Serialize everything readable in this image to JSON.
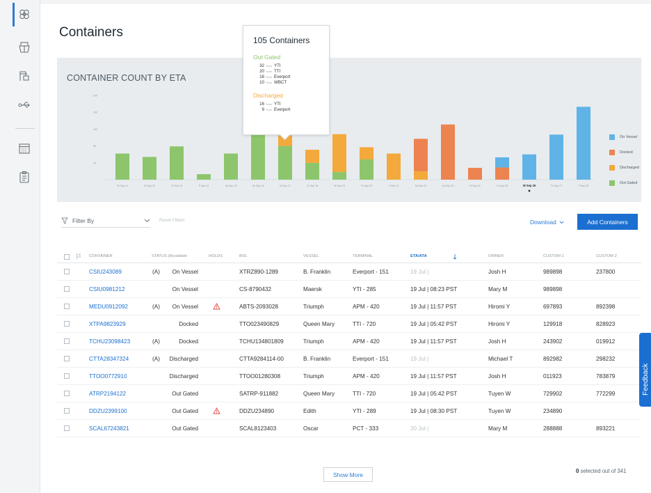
{
  "page": {
    "title": "Containers"
  },
  "sidebar": {
    "icons": [
      "containers-icon",
      "vessel-icon",
      "terminal-icon",
      "usb-route-icon",
      "calendar-icon",
      "clipboard-icon"
    ]
  },
  "chart": {
    "title": "CONTAINER COUNT BY ETA"
  },
  "tooltip": {
    "title": "105 Containers",
    "groups": [
      {
        "name": "Out Gated",
        "color": "#8dc56c",
        "rows": [
          {
            "count": "32",
            "from": "from",
            "terminal": "YTI"
          },
          {
            "count": "20",
            "from": "from",
            "terminal": "TTI"
          },
          {
            "count": "18",
            "from": "from",
            "terminal": "Everport"
          },
          {
            "count": "10",
            "from": "from",
            "terminal": "WBCT"
          }
        ]
      },
      {
        "name": "Discharged",
        "color": "#f3a93b",
        "rows": [
          {
            "count": "16",
            "from": "from",
            "terminal": "YTI"
          },
          {
            "count": "9",
            "from": "from",
            "terminal": "Everport"
          }
        ]
      }
    ]
  },
  "chart_data": {
    "type": "bar",
    "title": "CONTAINER COUNT BY ETA",
    "stacked": true,
    "categories": [
      "Tu Sep 11",
      "W Sep 12",
      "Th Sep 13",
      "F Sep 14",
      "Sa Sep 15",
      "Su Sep 16",
      "M Sep 17",
      "Tu Sep 18",
      "W Sep 19",
      "Th Sep 20",
      "F Sep 21",
      "Sa Sep 22",
      "Su Sep 23",
      "M Sep 24",
      "Tu Sep 25",
      "W Sep 26",
      "Th Sep 27",
      "F Sep 28"
    ],
    "highlighted_category": "W Sep 26",
    "y_ticks": [
      "40",
      "80",
      "120",
      "160",
      "200"
    ],
    "ylim": [
      0,
      210
    ],
    "legend_position": "right",
    "series": [
      {
        "name": "On Vessel",
        "color": "#5fb3e6",
        "values": [
          0,
          0,
          0,
          0,
          0,
          0,
          0,
          0,
          0,
          0,
          0,
          0,
          0,
          0,
          24,
          60,
          107,
          173
        ]
      },
      {
        "name": "Docked",
        "color": "#ec8350",
        "values": [
          0,
          0,
          0,
          0,
          0,
          0,
          0,
          0,
          0,
          0,
          0,
          77,
          131,
          28,
          29,
          0,
          0,
          0
        ]
      },
      {
        "name": "Discharged",
        "color": "#f3a93b",
        "values": [
          0,
          0,
          0,
          0,
          0,
          0,
          25,
          31,
          90,
          29,
          62,
          20,
          0,
          0,
          0,
          0,
          0,
          0
        ]
      },
      {
        "name": "Out Gated",
        "color": "#8dc56c",
        "values": [
          62,
          54,
          79,
          13,
          62,
          200,
          80,
          40,
          18,
          48,
          0,
          0,
          0,
          0,
          0,
          0,
          0,
          0
        ]
      }
    ]
  },
  "toolbar": {
    "filter_label": "Filter By",
    "reset_label": "Reset Filters",
    "download_label": "Download",
    "add_label": "Add Containers"
  },
  "table": {
    "headers": {
      "container": "CONTAINER",
      "status": "STATUS (A)vailable",
      "holds": "HOLDS",
      "bol": "BOL",
      "vessel": "VESSEL",
      "terminal": "TERMINAL",
      "eta": "ETA/ATA",
      "owner": "OWNER",
      "custom1": "CUSTOM 1",
      "custom2": "CUSTOM 2"
    },
    "rows": [
      {
        "container": "CSIU243089",
        "avail": "(A)",
        "status": "On Vessel",
        "hold": false,
        "bol": "XTRZ890-1289",
        "vessel": "B. Franklin",
        "terminal": "Everport - 151",
        "eta": "19 Jul |",
        "eta_muted": true,
        "owner": "Josh H",
        "custom1": "989898",
        "custom2": "237800"
      },
      {
        "container": "CSIU0981212",
        "avail": "",
        "status": "On Vessel",
        "hold": false,
        "bol": "CS-8790432",
        "vessel": "Maersk",
        "terminal": "YTI - 285",
        "eta": "19 Jul | 08:23 PST",
        "eta_muted": false,
        "owner": "Mary M",
        "custom1": "989898",
        "custom2": ""
      },
      {
        "container": "MEDU0912092",
        "avail": "(A)",
        "status": "On Vessel",
        "hold": true,
        "bol": "ABTS-2093028",
        "vessel": "Triumph",
        "terminal": "APM - 420",
        "eta": "19 Jul | 11:57 PST",
        "eta_muted": false,
        "owner": "Hiromi Y",
        "custom1": "697893",
        "custom2": "892398"
      },
      {
        "container": "XTPA9823929",
        "avail": "",
        "status": "Docked",
        "hold": false,
        "bol": "TTO023490829",
        "vessel": "Queen Mary",
        "terminal": "TTI - 720",
        "eta": "19 Jul | 05:42 PST",
        "eta_muted": false,
        "owner": "Hiromi Y",
        "custom1": "129918",
        "custom2": "828923"
      },
      {
        "container": "TCHU23098423",
        "avail": "(A)",
        "status": "Docked",
        "hold": false,
        "bol": "TCHU134801809",
        "vessel": "Triumph",
        "terminal": "APM - 420",
        "eta": "19 Jul | 11:57 PST",
        "eta_muted": false,
        "owner": "Josh H",
        "custom1": "243902",
        "custom2": "019912"
      },
      {
        "container": "CTTA28347324",
        "avail": "(A)",
        "status": "Discharged",
        "hold": false,
        "bol": "CTTA9284114-00",
        "vessel": "B. Franklin",
        "terminal": "Everport - 151",
        "eta": "19 Jul |",
        "eta_muted": true,
        "owner": "Michael T",
        "custom1": "892982",
        "custom2": "298232"
      },
      {
        "container": "TTOO0772910",
        "avail": "",
        "status": "Discharged",
        "hold": false,
        "bol": "TTOO01280308",
        "vessel": "Triumph",
        "terminal": "APM - 420",
        "eta": "19 Jul | 11:57 PST",
        "eta_muted": false,
        "owner": "Josh H",
        "custom1": "011923",
        "custom2": "783879"
      },
      {
        "container": "ATRP2194122",
        "avail": "",
        "status": "Out Gated",
        "hold": false,
        "bol": "SATRP-911882",
        "vessel": "Queen Mary",
        "terminal": "TTI - 720",
        "eta": "19 Jul | 05:42 PST",
        "eta_muted": false,
        "owner": "Tuyen W",
        "custom1": "729902",
        "custom2": "772299"
      },
      {
        "container": "DDZU2399100",
        "avail": "",
        "status": "Out Gated",
        "hold": true,
        "bol": "DDZU234890",
        "vessel": "Edith",
        "terminal": "YTI - 289",
        "eta": "19 Jul | 08:30 PST",
        "eta_muted": false,
        "owner": "Tuyen W",
        "custom1": "234890",
        "custom2": ""
      },
      {
        "container": "SCAL67243821",
        "avail": "",
        "status": "Out Gated",
        "hold": false,
        "bol": "SCAL8123403",
        "vessel": "Oscar",
        "terminal": "PCT - 333",
        "eta": "20 Jul |",
        "eta_muted": true,
        "owner": "Mary M",
        "custom1": "288888",
        "custom2": "893221"
      }
    ]
  },
  "footer": {
    "show_more": "Show More",
    "selected_count": "0",
    "selected_suffix": "selected out of 341"
  },
  "feedback_label": "Feedback"
}
